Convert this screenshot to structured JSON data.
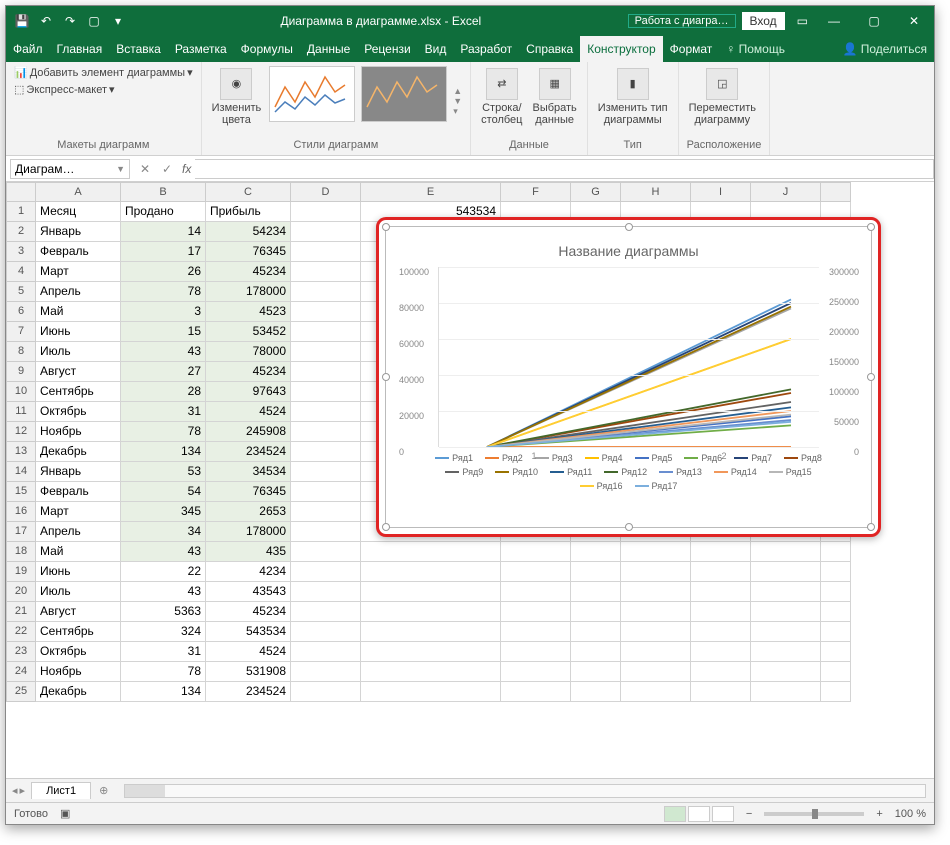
{
  "title": "Диаграмма в диаграмме.xlsx  -  Excel",
  "context_tab": "Работа с диагра…",
  "login": "Вход",
  "tabs": [
    "Файл",
    "Главная",
    "Вставка",
    "Разметка",
    "Формулы",
    "Данные",
    "Рецензи",
    "Вид",
    "Разработ",
    "Справка",
    "Конструктор",
    "Формат"
  ],
  "active_tab": "Конструктор",
  "help_icon": "♀",
  "help_text": "Помощь",
  "share": "Поделиться",
  "ribbon": {
    "layouts": {
      "add_element": "Добавить элемент диаграммы",
      "express": "Экспресс-макет",
      "group": "Макеты диаграмм"
    },
    "styles": {
      "change_colors": "Изменить\nцвета",
      "group": "Стили диаграмм"
    },
    "data": {
      "switch": "Строка/\nстолбец",
      "select": "Выбрать\nданные",
      "group": "Данные"
    },
    "type": {
      "change_type": "Изменить тип\nдиаграммы",
      "group": "Тип"
    },
    "location": {
      "move": "Переместить\nдиаграмму",
      "group": "Расположение"
    }
  },
  "namebox": "Диаграм…",
  "columns": [
    "A",
    "B",
    "C",
    "D",
    "E",
    "F",
    "G",
    "H",
    "I",
    "J",
    ""
  ],
  "headers": {
    "a": "Месяц",
    "b": "Продано",
    "c": "Прибыль"
  },
  "e1_value": "543534",
  "rows": [
    {
      "n": 1,
      "a": "Месяц",
      "b": "Продано",
      "c": "Прибыль",
      "hdr": true
    },
    {
      "n": 2,
      "a": "Январь",
      "b": 14,
      "c": 54234
    },
    {
      "n": 3,
      "a": "Февраль",
      "b": 17,
      "c": 76345
    },
    {
      "n": 4,
      "a": "Март",
      "b": 26,
      "c": 45234
    },
    {
      "n": 5,
      "a": "Апрель",
      "b": 78,
      "c": 178000
    },
    {
      "n": 6,
      "a": "Май",
      "b": 3,
      "c": 4523
    },
    {
      "n": 7,
      "a": "Июнь",
      "b": 15,
      "c": 53452
    },
    {
      "n": 8,
      "a": "Июль",
      "b": 43,
      "c": 78000
    },
    {
      "n": 9,
      "a": "Август",
      "b": 27,
      "c": 45234
    },
    {
      "n": 10,
      "a": "Сентябрь",
      "b": 28,
      "c": 97643
    },
    {
      "n": 11,
      "a": "Октябрь",
      "b": 31,
      "c": 4524
    },
    {
      "n": 12,
      "a": "Ноябрь",
      "b": 78,
      "c": 245908
    },
    {
      "n": 13,
      "a": "Декабрь",
      "b": 134,
      "c": 234524
    },
    {
      "n": 14,
      "a": "Январь",
      "b": 53,
      "c": 34534
    },
    {
      "n": 15,
      "a": "Февраль",
      "b": 54,
      "c": 76345
    },
    {
      "n": 16,
      "a": "Март",
      "b": 345,
      "c": 2653
    },
    {
      "n": 17,
      "a": "Апрель",
      "b": 34,
      "c": 178000
    },
    {
      "n": 18,
      "a": "Май",
      "b": 43,
      "c": 435
    },
    {
      "n": 19,
      "a": "Июнь",
      "b": 22,
      "c": 4234,
      "unsel": true
    },
    {
      "n": 20,
      "a": "Июль",
      "b": 43,
      "c": 43543,
      "unsel": true
    },
    {
      "n": 21,
      "a": "Август",
      "b": 5363,
      "c": 45234,
      "unsel": true
    },
    {
      "n": 22,
      "a": "Сентябрь",
      "b": 324,
      "c": 543534,
      "unsel": true
    },
    {
      "n": 23,
      "a": "Октябрь",
      "b": 31,
      "c": 4524,
      "unsel": true
    },
    {
      "n": 24,
      "a": "Ноябрь",
      "b": 78,
      "c": 531908,
      "unsel": true
    },
    {
      "n": 25,
      "a": "Декабрь",
      "b": 134,
      "c": 234524,
      "unsel": true
    }
  ],
  "chart_data": {
    "type": "line",
    "title": "Название диаграммы",
    "xlabel": "",
    "ylabel": "",
    "x_ticks": [
      "1",
      "2"
    ],
    "y_left": {
      "min": 0,
      "max": 100000,
      "ticks": [
        0,
        20000,
        40000,
        60000,
        80000,
        100000
      ]
    },
    "y_right": {
      "min": 0,
      "max": 300000,
      "ticks": [
        0,
        50000,
        100000,
        150000,
        200000,
        250000,
        300000
      ]
    },
    "series": [
      {
        "name": "Ряд1",
        "color": "#5b9bd5"
      },
      {
        "name": "Ряд2",
        "color": "#ed7d31"
      },
      {
        "name": "Ряд3",
        "color": "#a5a5a5"
      },
      {
        "name": "Ряд4",
        "color": "#ffc000"
      },
      {
        "name": "Ряд5",
        "color": "#4472c4"
      },
      {
        "name": "Ряд6",
        "color": "#70ad47"
      },
      {
        "name": "Ряд7",
        "color": "#264478"
      },
      {
        "name": "Ряд8",
        "color": "#9e480e"
      },
      {
        "name": "Ряд9",
        "color": "#636363"
      },
      {
        "name": "Ряд10",
        "color": "#997300"
      },
      {
        "name": "Ряд11",
        "color": "#255e91"
      },
      {
        "name": "Ряд12",
        "color": "#43682b"
      },
      {
        "name": "Ряд13",
        "color": "#698ed0"
      },
      {
        "name": "Ряд14",
        "color": "#f1975a"
      },
      {
        "name": "Ряд15",
        "color": "#b7b7b7"
      },
      {
        "name": "Ряд16",
        "color": "#ffcd33"
      },
      {
        "name": "Ряд17",
        "color": "#7cafdd"
      }
    ],
    "line_endpoints_left_axis": [
      {
        "name": "Ряд1",
        "y1": 0,
        "y2": 82000
      },
      {
        "name": "Ряд2",
        "y1": 0,
        "y2": 0
      },
      {
        "name": "Ряд3",
        "y1": 0,
        "y2": 77000
      },
      {
        "name": "Ряд4",
        "y1": 0,
        "y2": 60000
      },
      {
        "name": "Ряд5",
        "y1": 0,
        "y2": 17000
      },
      {
        "name": "Ряд6",
        "y1": 0,
        "y2": 12000
      },
      {
        "name": "Ряд7",
        "y1": 0,
        "y2": 80000
      },
      {
        "name": "Ряд8",
        "y1": 0,
        "y2": 30000
      },
      {
        "name": "Ряд9",
        "y1": 0,
        "y2": 25000
      },
      {
        "name": "Ряд10",
        "y1": 0,
        "y2": 78000
      },
      {
        "name": "Ряд11",
        "y1": 0,
        "y2": 22000
      },
      {
        "name": "Ряд12",
        "y1": 0,
        "y2": 32000
      },
      {
        "name": "Ряд13",
        "y1": 0,
        "y2": 15000
      },
      {
        "name": "Ряд14",
        "y1": 0,
        "y2": 20000
      },
      {
        "name": "Ряд15",
        "y1": 0,
        "y2": 18000
      },
      {
        "name": "Ряд16",
        "y1": 0,
        "y2": 60000
      },
      {
        "name": "Ряд17",
        "y1": 0,
        "y2": 14000
      }
    ]
  },
  "sheet": "Лист1",
  "status_text": "Готово",
  "zoom": "100 %"
}
